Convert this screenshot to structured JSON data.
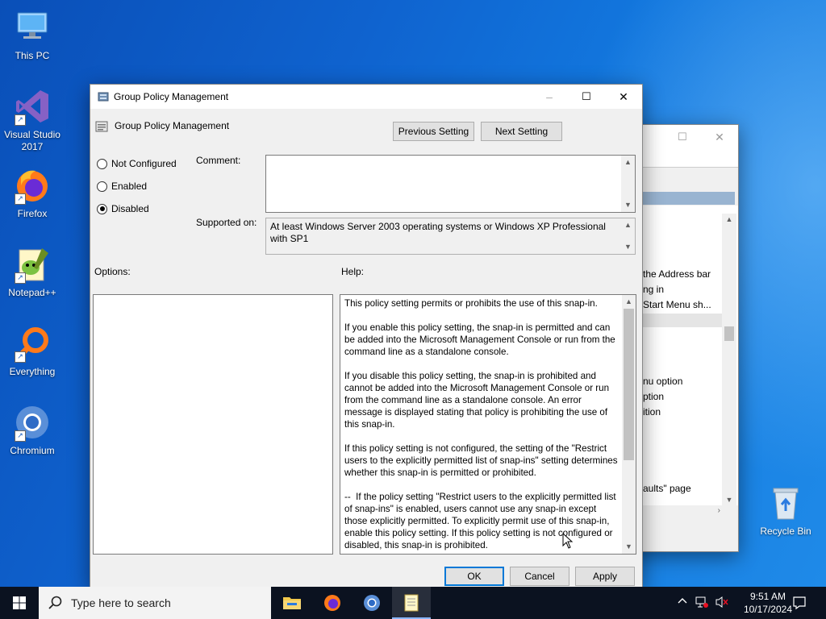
{
  "desktop": {
    "icons": [
      {
        "label": "This PC"
      },
      {
        "label": "Visual Studio 2017"
      },
      {
        "label": "Firefox"
      },
      {
        "label": "Notepad++"
      },
      {
        "label": "Everything"
      },
      {
        "label": "Chromium"
      },
      {
        "label": "Recycle Bin"
      }
    ]
  },
  "bg_window": {
    "list_items": [
      "the Address bar",
      "ng in",
      "Start Menu sh...",
      "nu option",
      "ption",
      "ition",
      "aults\" page"
    ]
  },
  "dialog": {
    "title": "Group Policy Management",
    "header_title": "Group Policy Management",
    "prev_button": "Previous Setting",
    "next_button": "Next Setting",
    "radio_options": [
      {
        "label": "Not Configured",
        "selected": false
      },
      {
        "label": "Enabled",
        "selected": false
      },
      {
        "label": "Disabled",
        "selected": true
      }
    ],
    "comment_label": "Comment:",
    "comment_value": "",
    "supported_label": "Supported on:",
    "supported_value": "At least Windows Server 2003 operating systems or Windows XP Professional with SP1",
    "options_label": "Options:",
    "help_label": "Help:",
    "help_text": "This policy setting permits or prohibits the use of this snap-in.\n\nIf you enable this policy setting, the snap-in is permitted and can be added into the Microsoft Management Console or run from the command line as a standalone console.\n\nIf you disable this policy setting, the snap-in is prohibited and cannot be added into the Microsoft Management Console or run from the command line as a standalone console. An error message is displayed stating that policy is prohibiting the use of this snap-in.\n\nIf this policy setting is not configured, the setting of the \"Restrict users to the explicitly permitted list of snap-ins\" setting determines whether this snap-in is permitted or prohibited.\n\n--  If the policy setting \"Restrict users to the explicitly permitted list of snap-ins\" is enabled, users cannot use any snap-in except those explicitly permitted. To explicitly permit use of this snap-in, enable this policy setting. If this policy setting is not configured or disabled, this snap-in is prohibited.",
    "ok_button": "OK",
    "cancel_button": "Cancel",
    "apply_button": "Apply"
  },
  "taskbar": {
    "search_placeholder": "Type here to search",
    "time": "9:51 AM",
    "date": "10/17/2024"
  },
  "colors": {
    "accent": "#0078d7",
    "desktop": "#1a6fd6",
    "taskbar": "#0b1220"
  }
}
